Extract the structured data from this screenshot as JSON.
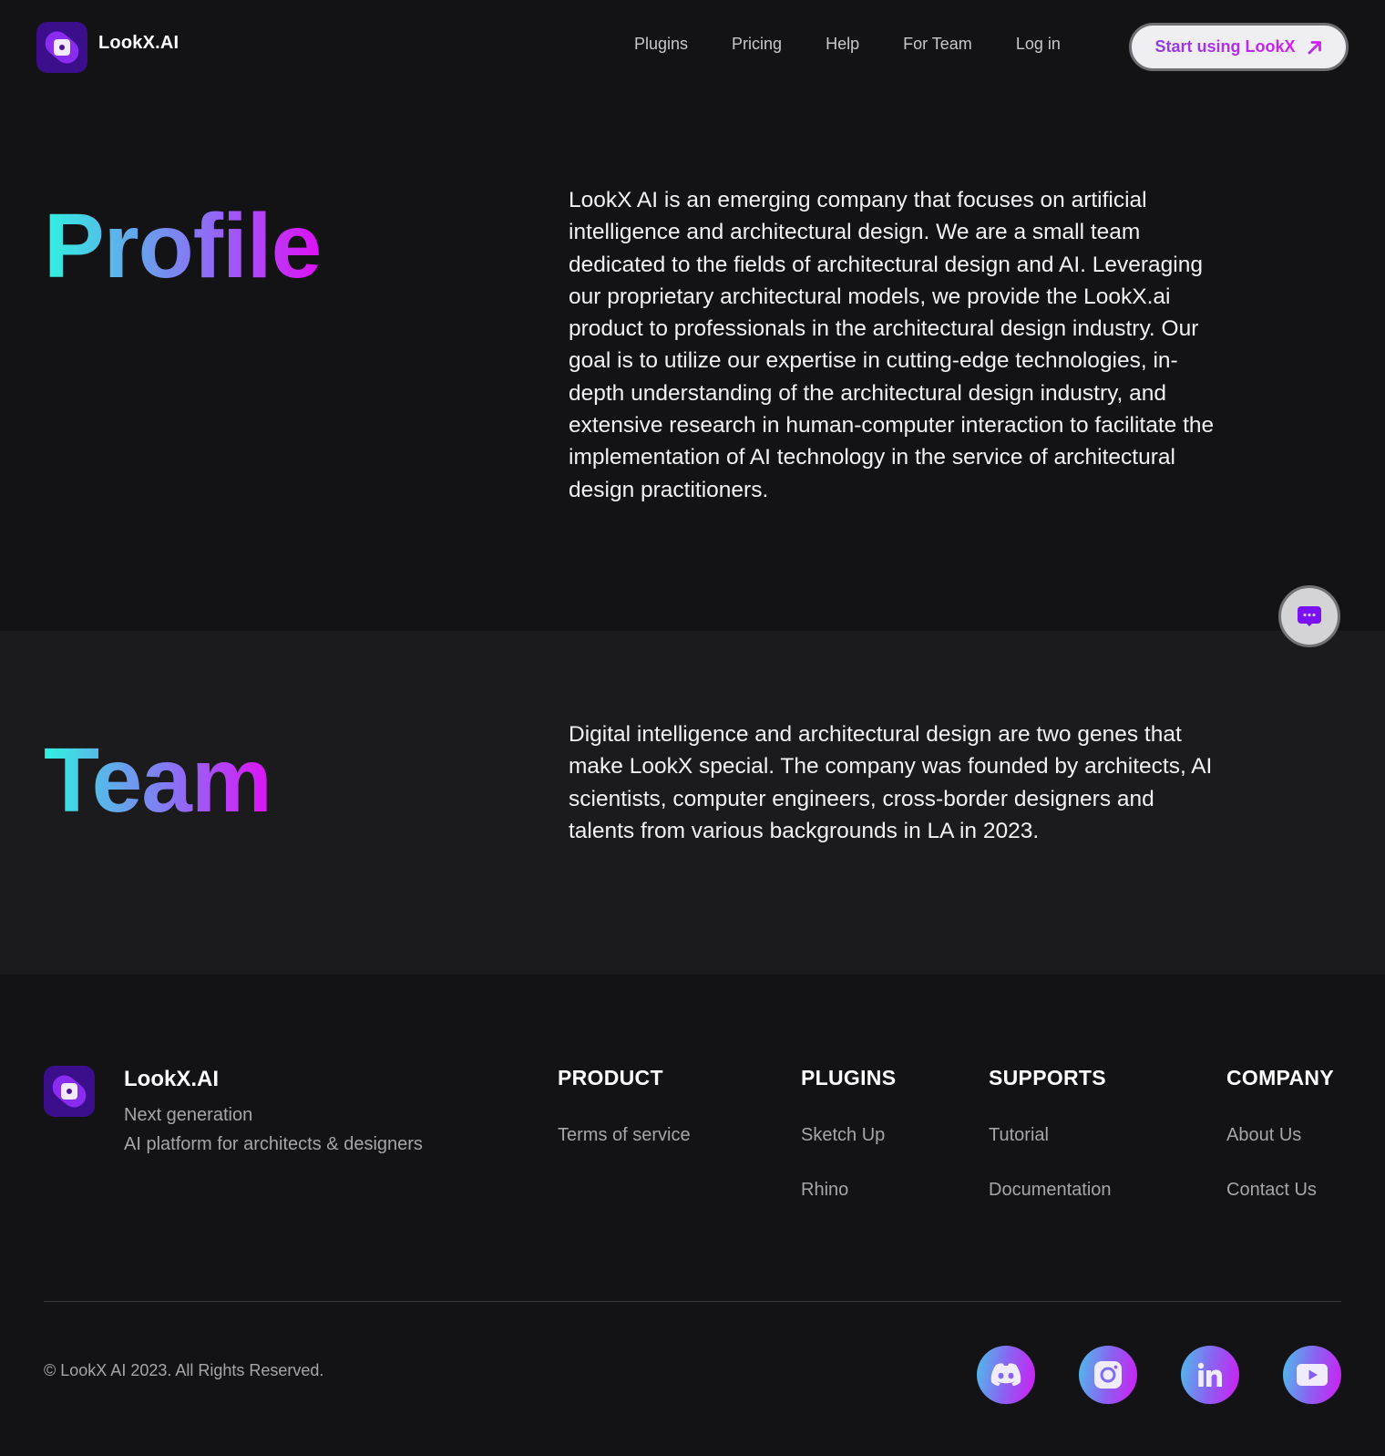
{
  "nav": {
    "brand": "LookX.AI",
    "links": [
      "Plugins",
      "Pricing",
      "Help",
      "For Team",
      "Log in"
    ],
    "cta_label": "Start using LookX"
  },
  "profile": {
    "title": "Profile",
    "body": "LookX AI is an emerging company that focuses on artificial intelligence and architectural design. We are a small team dedicated to the fields of architectural design and AI. Leveraging our proprietary architectural models, we provide the LookX.ai product to professionals in the architectural design industry. Our goal is to utilize our expertise in cutting-edge technologies, in-depth understanding of the architectural design industry, and extensive research in human-computer interaction to facilitate the implementation of AI technology in the service of architectural design practitioners."
  },
  "team": {
    "title": "Team",
    "body": "Digital intelligence and architectural design are two genes that make LookX special. The company was founded by architects, AI scientists, computer engineers, cross-border designers and talents from various backgrounds in LA in 2023."
  },
  "chat_button": {
    "icon": "chat-bubble-icon"
  },
  "footer": {
    "brand": "LookX.AI",
    "tagline_line1": "Next generation",
    "tagline_line2": "AI platform for architects & designers",
    "columns": [
      {
        "heading": "PRODUCT",
        "links": [
          "Terms of service"
        ]
      },
      {
        "heading": "PLUGINS",
        "links": [
          "Sketch Up",
          "Rhino"
        ]
      },
      {
        "heading": "SUPPORTS",
        "links": [
          "Tutorial",
          "Documentation"
        ]
      },
      {
        "heading": "COMPANY",
        "links": [
          "About Us",
          "Contact Us"
        ]
      }
    ],
    "copyright": "© LookX AI 2023. All Rights Reserved.",
    "socials": [
      "discord-icon",
      "instagram-icon",
      "linkedin-icon",
      "youtube-icon"
    ]
  },
  "colors": {
    "background": "#131316",
    "section_alt": "#1b1b1e",
    "gradient_start": "#2ff3e0",
    "gradient_end": "#df10f6",
    "logo_bg": "#3b0f8c",
    "chat_icon": "#7a12f4"
  }
}
